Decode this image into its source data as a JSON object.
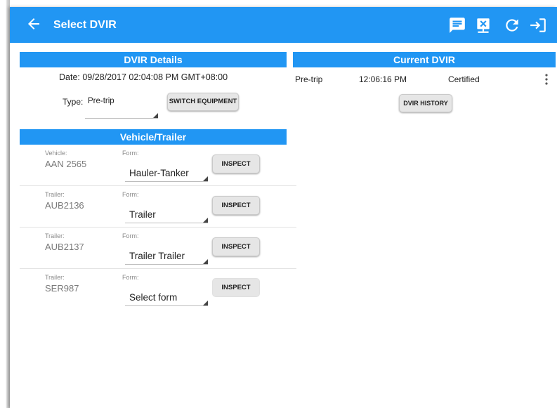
{
  "appbar": {
    "title": "Select DVIR",
    "icons": [
      "back-arrow-icon",
      "message-icon",
      "close-sync-icon",
      "refresh-icon",
      "logout-icon"
    ],
    "color": "#2196f3"
  },
  "dvir_details": {
    "header": "DVIR Details",
    "date_text": "Date: 09/28/2017 02:04:08 PM GMT+08:00",
    "type_label": "Type:",
    "type_value": "Pre-trip",
    "switch_button": "SWITCH EQUIPMENT"
  },
  "vehicle_trailer": {
    "header": "Vehicle/Trailer",
    "form_label": "Form:",
    "inspect_label": "INSPECT",
    "rows": [
      {
        "kind": "Vehicle:",
        "id": "AAN 2565",
        "form": "Hauler-Tanker"
      },
      {
        "kind": "Trailer:",
        "id": "AUB2136",
        "form": "Trailer"
      },
      {
        "kind": "Trailer:",
        "id": "AUB2137",
        "form": "Trailer Trailer"
      },
      {
        "kind": "Trailer:",
        "id": "SER987",
        "form": "Select form"
      }
    ]
  },
  "current_dvir": {
    "header": "Current DVIR",
    "entry": {
      "type": "Pre-trip",
      "time": "12:06:16 PM",
      "status": "Certified"
    },
    "history_button": "DVIR HISTORY",
    "menu_icon": "more-vert-icon"
  }
}
